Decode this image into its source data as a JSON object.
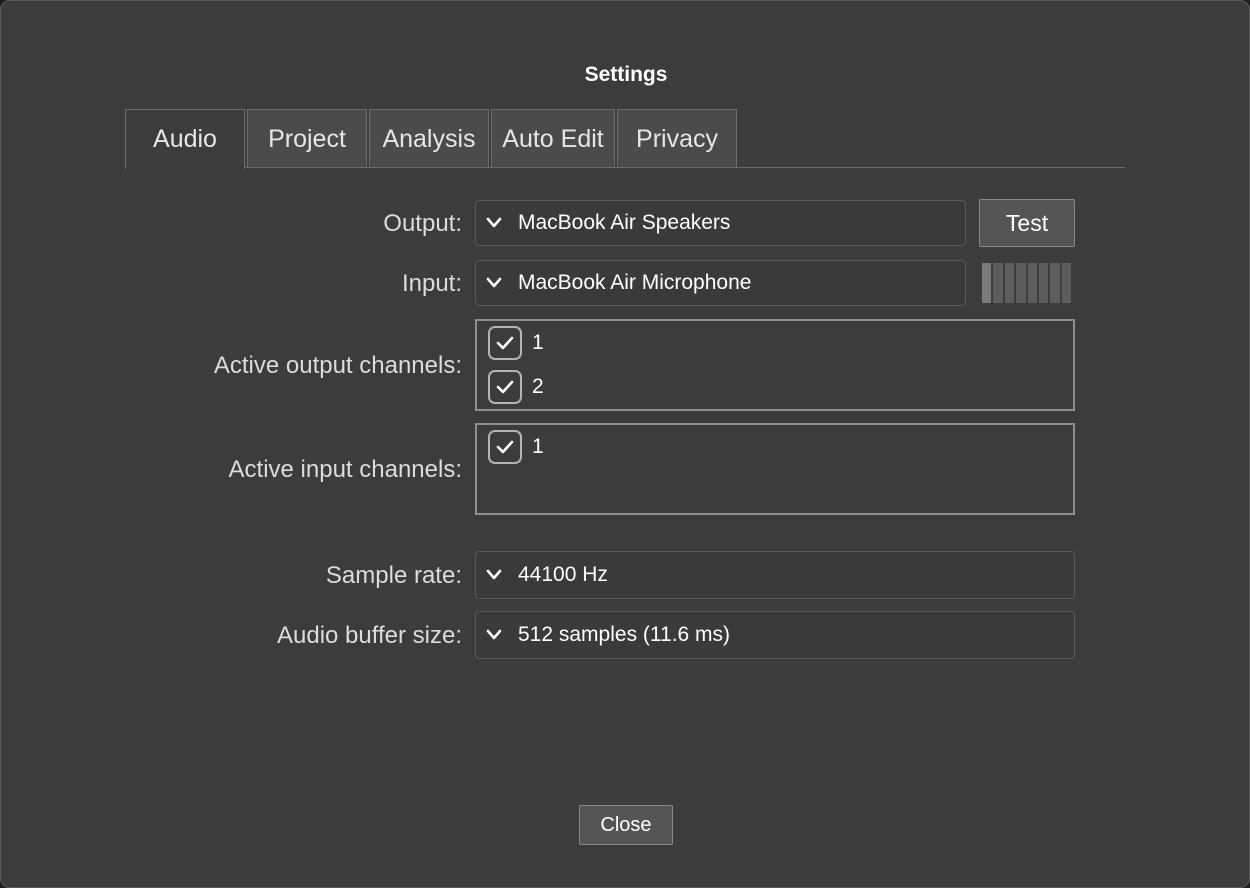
{
  "dialog": {
    "title": "Settings",
    "tabs": [
      {
        "label": "Audio",
        "active": true
      },
      {
        "label": "Project"
      },
      {
        "label": "Analysis"
      },
      {
        "label": "Auto Edit"
      },
      {
        "label": "Privacy"
      }
    ]
  },
  "audio": {
    "output": {
      "label": "Output:",
      "value": "MacBook Air Speakers",
      "test_label": "Test"
    },
    "input": {
      "label": "Input:",
      "value": "MacBook Air Microphone",
      "level_segments_lit": 1,
      "level_segments_total": 8
    },
    "active_output_channels": {
      "label": "Active output channels:",
      "channels": [
        {
          "label": "1",
          "checked": true
        },
        {
          "label": "2",
          "checked": true
        }
      ]
    },
    "active_input_channels": {
      "label": "Active input channels:",
      "channels": [
        {
          "label": "1",
          "checked": true
        }
      ]
    },
    "sample_rate": {
      "label": "Sample rate:",
      "value": "44100 Hz"
    },
    "buffer_size": {
      "label": "Audio buffer size:",
      "value": "512 samples (11.6 ms)"
    }
  },
  "footer": {
    "close_label": "Close"
  },
  "icons": {
    "dropdown": "chevron-down-icon",
    "check": "checkmark-icon"
  },
  "colors": {
    "background": "#3c3c3c",
    "text": "#ffffff",
    "border": "#8e8e8e"
  }
}
